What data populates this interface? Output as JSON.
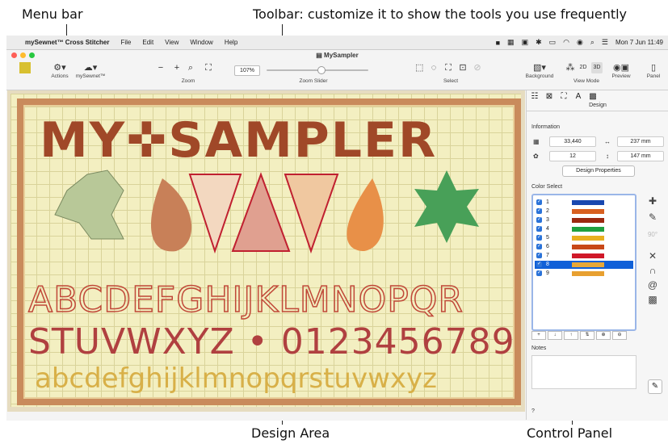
{
  "annotations": {
    "menu_bar": "Menu bar",
    "toolbar": "Toolbar: customize it to show the tools you use frequently",
    "design_area": "Design Area",
    "control_panel": "Control Panel"
  },
  "menubar": {
    "app_name": "mySewnet™ Cross Stitcher",
    "items": [
      "File",
      "Edit",
      "View",
      "Window",
      "Help"
    ],
    "clock": "Mon 7 Jun  11:49"
  },
  "window": {
    "title": "MySampler"
  },
  "toolbar": {
    "actions_label": "Actions",
    "mysewnet_label": "mySewnet™",
    "zoom_label": "Zoom",
    "zoom_value": "107%",
    "zoom_slider_label": "Zoom Slider",
    "zoom_slider_level": 0.5,
    "select_label": "Select",
    "background_label": "Background",
    "view_mode_label": "View Mode",
    "view_mode_2d": "2D",
    "view_mode_3d": "3D",
    "preview_label": "Preview",
    "panel_label": "Panel"
  },
  "design": {
    "title_text": "MY✜SAMPLER",
    "alphabet_upper_1": "ABCDEFGHIJKLMNOPQR",
    "alphabet_upper_2": "STUVWXYZ • 0123456789",
    "alphabet_lower": "abcdefghijklmnopqrstuvwxyz"
  },
  "panel": {
    "title": "Design",
    "info_heading": "Information",
    "stitches": "33,440",
    "width": "237 mm",
    "colors": "12",
    "height": "147 mm",
    "properties_button": "Design Properties",
    "color_select_heading": "Color Select",
    "colors_list": [
      {
        "num": "1",
        "color": "#1848b0"
      },
      {
        "num": "2",
        "color": "#d86020"
      },
      {
        "num": "3",
        "color": "#9c2810"
      },
      {
        "num": "4",
        "color": "#20a040"
      },
      {
        "num": "5",
        "color": "#e8b020"
      },
      {
        "num": "6",
        "color": "#c84818"
      },
      {
        "num": "7",
        "color": "#d01828"
      },
      {
        "num": "8",
        "color": "#e8a838"
      },
      {
        "num": "9",
        "color": "#e8a030"
      }
    ],
    "selected_color": "8",
    "notes_heading": "Notes",
    "help": "?"
  }
}
